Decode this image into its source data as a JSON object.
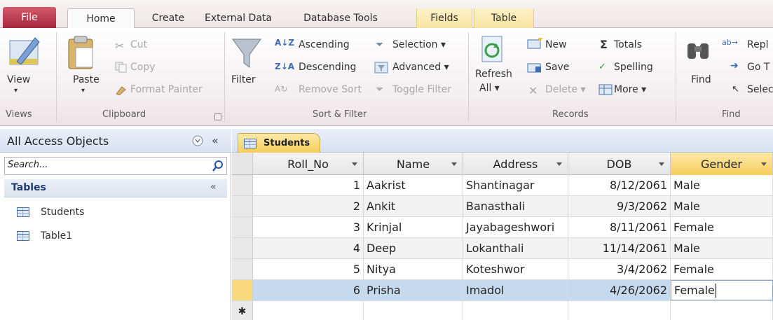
{
  "ribbon_tabs": [
    "File",
    "Home",
    "Create",
    "External Data",
    "Database Tools",
    "Fields",
    "Table"
  ],
  "views": {
    "view_label": "View",
    "group": "Views"
  },
  "clipboard": {
    "paste": "Paste",
    "cut": "Cut",
    "copy": "Copy",
    "format_painter": "Format Painter",
    "group": "Clipboard"
  },
  "sort_filter": {
    "filter": "Filter",
    "ascending": "Ascending",
    "descending": "Descending",
    "remove_sort": "Remove Sort",
    "selection": "Selection ▾",
    "advanced": "Advanced ▾",
    "toggle_filter": "Toggle Filter",
    "group": "Sort & Filter"
  },
  "records": {
    "refresh": "Refresh",
    "refresh_all": "All ▾",
    "new": "New",
    "save": "Save",
    "delete": "Delete ▾",
    "totals": "Totals",
    "spelling": "Spelling",
    "more": "More ▾",
    "group": "Records"
  },
  "find": {
    "find": "Find",
    "replace": "Repl",
    "goto": "Go T",
    "select": "Selec",
    "group": "Find"
  },
  "nav": {
    "title": "All Access Objects",
    "search_placeholder": "Search...",
    "section": "Tables",
    "items": [
      "Students",
      "Table1"
    ]
  },
  "doc": {
    "tab_label": "Students"
  },
  "table": {
    "columns": [
      "Roll_No",
      "Name",
      "Address",
      "DOB",
      "Gender"
    ],
    "rows": [
      [
        "1",
        "Aakrist",
        "Shantinagar",
        "8/12/2061",
        "Male"
      ],
      [
        "2",
        "Ankit",
        "Banasthali",
        "9/3/2062",
        "Male"
      ],
      [
        "3",
        "Krinjal",
        "Jayabageshwori",
        "8/11/2061",
        "Female"
      ],
      [
        "4",
        "Deep",
        "Lokanthali",
        "11/14/2061",
        "Male"
      ],
      [
        "5",
        "Nitya",
        "Koteshwor",
        "3/4/2062",
        "Female"
      ],
      [
        "6",
        "Prisha",
        "Imadol",
        "4/26/2062",
        "Female"
      ]
    ],
    "new_row_marker": "✱"
  },
  "icons": {
    "nav_menu": "circle-chevron-down-icon",
    "nav_collapse": "double-chevron-left-icon",
    "search": "search-icon",
    "section_collapse": "double-chevron-up-icon"
  },
  "colors": {
    "file_tab": "#b83246",
    "selected_row": "#c5d9ef",
    "active_header": "#f6cd5c"
  }
}
